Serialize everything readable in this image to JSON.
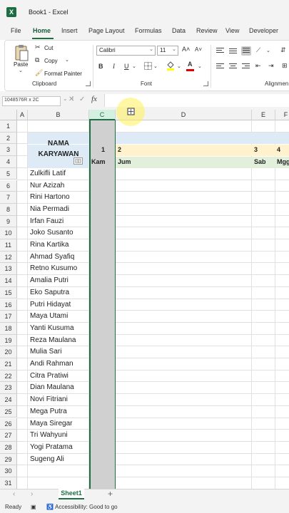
{
  "app": {
    "logo_letter": "X",
    "document_title": "Book1  -  Excel"
  },
  "ribbon_tabs": [
    "File",
    "Home",
    "Insert",
    "Page Layout",
    "Formulas",
    "Data",
    "Review",
    "View",
    "Developer"
  ],
  "active_tab": "Home",
  "clipboard": {
    "paste_label": "Paste",
    "cut_label": "Cut",
    "copy_label": "Copy",
    "format_painter_label": "Format Painter",
    "group_label": "Clipboard"
  },
  "font_group": {
    "font_name": "Calibri",
    "font_size": "11",
    "grow_label": "A˄",
    "shrink_label": "A˅",
    "bold": "B",
    "italic": "I",
    "underline": "U",
    "font_color_letter": "A",
    "group_label": "Font"
  },
  "alignment_group": {
    "group_label": "Alignmen"
  },
  "formula_bar": {
    "name_box": "1048576R x 2C",
    "cancel_glyph": "✕",
    "enter_glyph": "✓",
    "fx_label": "fx",
    "formula_value": ""
  },
  "columns": [
    "A",
    "B",
    "C",
    "D",
    "E",
    "F"
  ],
  "selected_column": "C",
  "rows": [
    "1",
    "2",
    "3",
    "4",
    "5",
    "6",
    "7",
    "8",
    "9",
    "10",
    "11",
    "12",
    "13",
    "14",
    "15",
    "16",
    "17",
    "18",
    "19",
    "20",
    "21",
    "22",
    "23",
    "24",
    "25",
    "26",
    "27",
    "28",
    "29",
    "30",
    "31"
  ],
  "sheet": {
    "header_label_line1": "NAMA",
    "header_label_line2": "KARYAWAN",
    "day_numbers": [
      "1",
      "2",
      "3",
      "4"
    ],
    "day_names": [
      "Kam",
      "Jum",
      "Sab",
      "Mgg"
    ],
    "employees": [
      "Zulkifli Latif",
      "Nur Azizah",
      "Rini Hartono",
      "Nia Permadi",
      "Irfan Fauzi",
      "Joko Susanto",
      "Rina Kartika",
      "Ahmad Syafiq",
      "Retno Kusumo",
      "Amalia Putri",
      "Eko Saputra",
      "Putri Hidayat",
      "Maya Utami",
      "Yanti Kusuma",
      "Reza Maulana",
      "Mulia Sari",
      "Andi Rahman",
      "Citra Pratiwi",
      "Dian Maulana",
      "Novi Fitriani",
      "Mega Putra",
      "Maya Siregar",
      "Tri Wahyuni",
      "Yogi Pratama",
      "Sugeng Ali"
    ]
  },
  "sheet_tabs": [
    "Sheet1"
  ],
  "add_sheet_glyph": "+",
  "status": {
    "ready": "Ready",
    "accessibility": "Accessibility: Good to go"
  },
  "colors": {
    "accent": "#1d6f42",
    "header_band": "#deebf7",
    "day_number_band": "#fff2cc",
    "day_name_band": "#e2efda",
    "selected_column_fill": "#d0d0d0"
  }
}
